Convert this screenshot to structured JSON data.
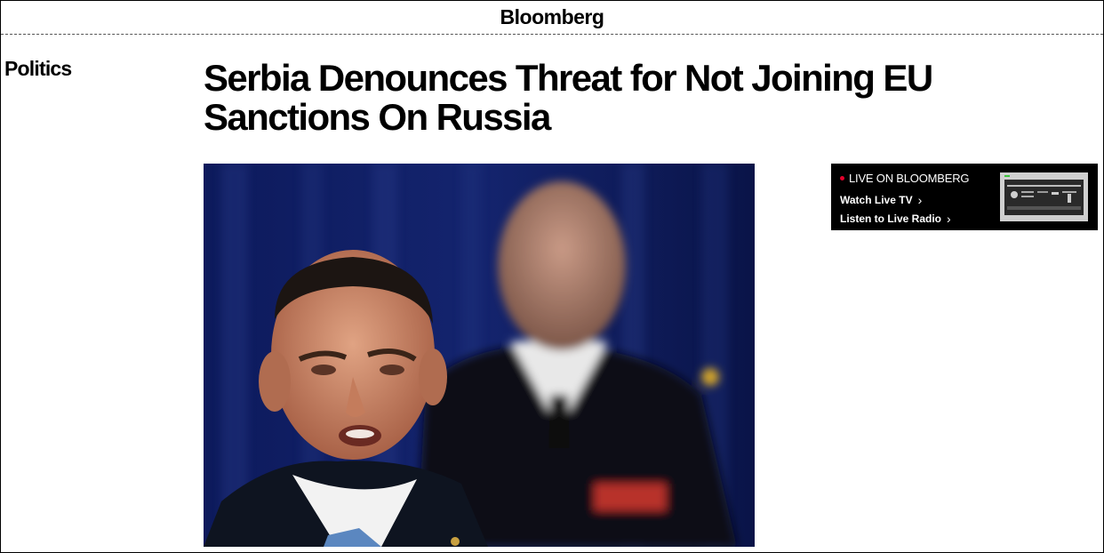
{
  "brand": {
    "logo": "Bloomberg"
  },
  "article": {
    "section": "Politics",
    "headline": "Serbia Denounces Threat for Not Joining EU Sanctions On Russia"
  },
  "live_widget": {
    "label": "LIVE ON BLOOMBERG",
    "watch_link": "Watch Live TV",
    "listen_link": "Listen to Live Radio",
    "accent_color": "#e4002b"
  },
  "icons": {
    "chevron": "chevron-right-icon",
    "live": "live-dot-icon"
  }
}
